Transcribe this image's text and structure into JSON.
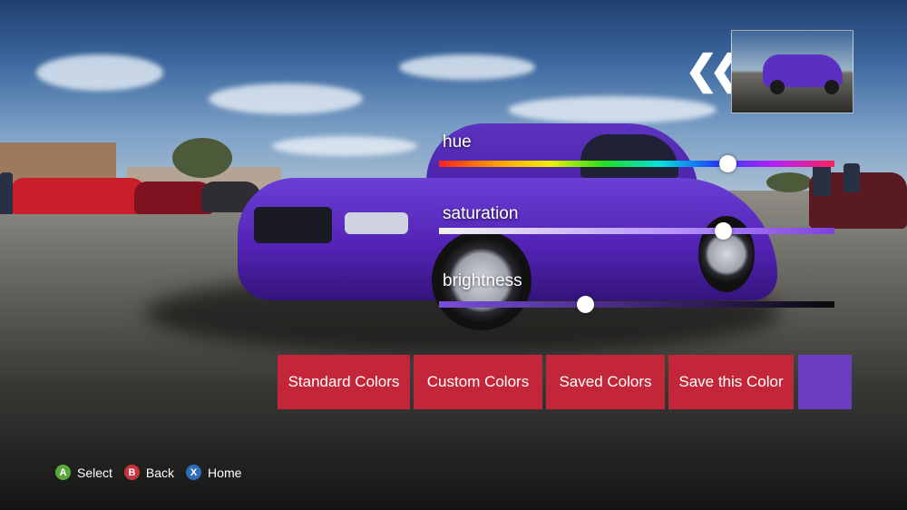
{
  "colors": {
    "accent_button": "#c32638",
    "selected_color": "#6a3cbf",
    "gamepad_a": "#5aa83a",
    "gamepad_b": "#c8333b",
    "gamepad_x": "#2f6fb5"
  },
  "navigation": {
    "back_icon": "double-chevron-left-icon"
  },
  "preview": {
    "thumbnail": "car-preview-thumbnail"
  },
  "sliders": {
    "hue": {
      "label": "hue",
      "value": 0.73
    },
    "saturation": {
      "label": "saturation",
      "value": 0.72
    },
    "brightness": {
      "label": "brightness",
      "value": 0.37
    }
  },
  "buttons": {
    "standard": "Standard Colors",
    "custom": "Custom Colors",
    "saved": "Saved Colors",
    "save": "Save this Color"
  },
  "hints": [
    {
      "button": "A",
      "label": "Select"
    },
    {
      "button": "B",
      "label": "Back"
    },
    {
      "button": "X",
      "label": "Home"
    }
  ]
}
